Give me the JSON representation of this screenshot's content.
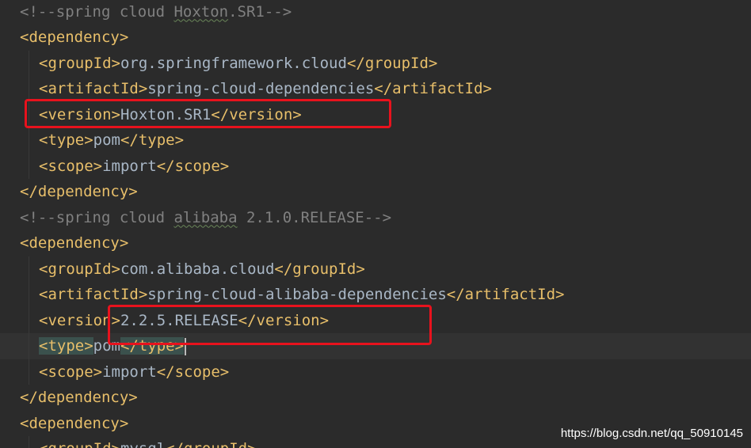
{
  "editor": {
    "language": "xml",
    "lines": [
      {
        "kind": "comment",
        "indent": 0,
        "open": "<!--spring cloud ",
        "typo": "Hoxton",
        "close": ".SR1-->"
      },
      {
        "kind": "tag",
        "indent": 0,
        "open": "<dependency>"
      },
      {
        "kind": "element",
        "indent": 1,
        "open": "<groupId>",
        "value": "org.springframework.cloud",
        "close": "</groupId>"
      },
      {
        "kind": "element",
        "indent": 1,
        "open": "<artifactId>",
        "value": "spring-cloud-dependencies",
        "close": "</artifactId>"
      },
      {
        "kind": "element",
        "indent": 1,
        "open": "<version>",
        "value": "Hoxton.SR1",
        "close": "</version>"
      },
      {
        "kind": "element",
        "indent": 1,
        "open": "<type>",
        "value": "pom",
        "close": "</type>"
      },
      {
        "kind": "element",
        "indent": 1,
        "open": "<scope>",
        "value": "import",
        "close": "</scope>"
      },
      {
        "kind": "tag",
        "indent": 0,
        "open": "</dependency>"
      },
      {
        "kind": "comment",
        "indent": 0,
        "open": "<!--spring cloud ",
        "typo": "alibaba",
        "close": " 2.1.0.RELEASE-->"
      },
      {
        "kind": "tag",
        "indent": 0,
        "open": "<dependency>"
      },
      {
        "kind": "element",
        "indent": 1,
        "open": "<groupId>",
        "value": "com.alibaba.cloud",
        "close": "</groupId>"
      },
      {
        "kind": "element",
        "indent": 1,
        "open": "<artifactId>",
        "value": "spring-cloud-alibaba-dependencies",
        "close": "</artifactId>"
      },
      {
        "kind": "element",
        "indent": 1,
        "open": "<version>",
        "value": "2.2.5.RELEASE",
        "close": "</version>"
      },
      {
        "kind": "element",
        "indent": 1,
        "open": "<type>",
        "value": "pom",
        "close": "</type>",
        "current": true
      },
      {
        "kind": "element",
        "indent": 1,
        "open": "<scope>",
        "value": "import",
        "close": "</scope>"
      },
      {
        "kind": "tag",
        "indent": 0,
        "open": "</dependency>"
      },
      {
        "kind": "tag",
        "indent": 0,
        "open": "<dependency>"
      },
      {
        "kind": "element",
        "indent": 1,
        "open": "<groupId>",
        "value": "mysql",
        "close": "</groupId>"
      }
    ]
  },
  "watermark": "https://blog.csdn.net/qq_50910145",
  "colors": {
    "background": "#2b2b2b",
    "tag": "#e8bf6a",
    "text": "#a9b7c6",
    "comment": "#808080",
    "annotation": "#e8121d"
  }
}
